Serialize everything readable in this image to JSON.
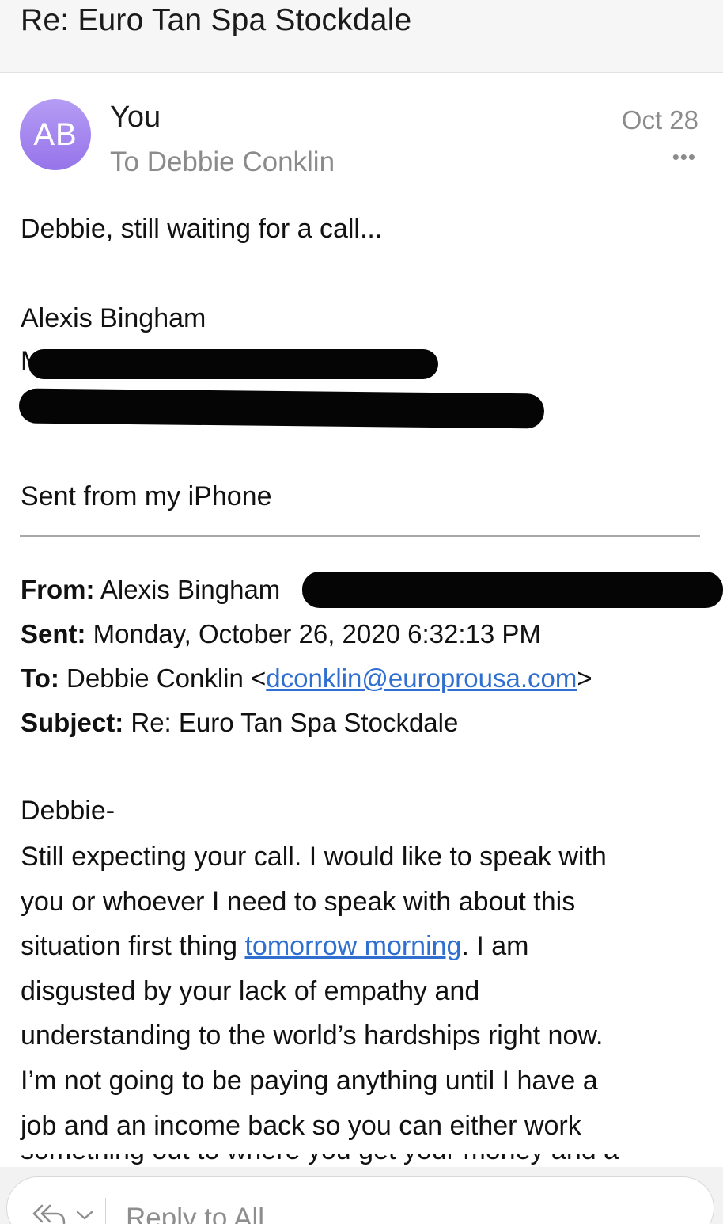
{
  "header": {
    "subject": "Re: Euro Tan Spa Stockdale"
  },
  "message": {
    "avatar_initials": "AB",
    "sender": "You",
    "recipient_line": "To Debbie Conklin",
    "date": "Oct 28",
    "more_icon": "•••",
    "body_first_line": "Debbie, still waiting for a call...",
    "signature_name": "Alexis Bingham",
    "signature_mobile_fragment": "M",
    "sent_from": "Sent from my iPhone"
  },
  "quoted": {
    "from_label": "From:",
    "from_value": "Alexis Bingham",
    "sent_label": "Sent:",
    "sent_value": "Monday, October 26, 2020 6:32:13 PM",
    "to_label": "To:",
    "to_name": "Debbie Conklin",
    "to_open": "<",
    "to_email": "dconklin@europrousa.com",
    "to_close": ">",
    "subject_label": "Subject:",
    "subject_value": "Re: Euro Tan Spa Stockdale",
    "greeting": "Debbie-",
    "body": {
      "line1": "Still expecting your call. I would like to speak with",
      "line2": "you or whoever I need to speak with about this",
      "line3_pre": "situation first thing ",
      "line3_link": "tomorrow morning",
      "line3_post": ". I am",
      "line4": "disgusted by your lack of empathy and",
      "line5": "understanding to the world’s hardships right now.",
      "line6": "I’m not going to be paying anything until I have a",
      "line7": "job and an income back so you can either work",
      "line8_partial": "something out to where you get your money and a"
    }
  },
  "reply_bar": {
    "reply_icon": "reply-all-icon",
    "label": "Reply to All"
  },
  "colors": {
    "avatar_gradient_top": "#b59cf4",
    "avatar_gradient_bottom": "#9674ea",
    "link": "#2f6fcf",
    "secondary_text": "#8b8b8b"
  }
}
